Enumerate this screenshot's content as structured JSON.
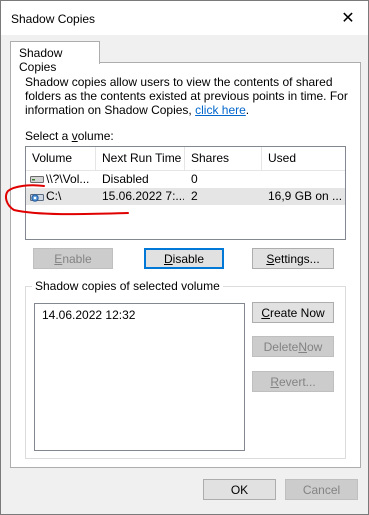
{
  "window": {
    "title": "Shadow Copies",
    "close_glyph": "✕"
  },
  "tabs": [
    {
      "label": "Shadow Copies"
    }
  ],
  "description": {
    "text": "Shadow copies allow users to view the contents of shared folders as the contents existed at previous points in time. For information on Shadow Copies, ",
    "link": "click here",
    "end": "."
  },
  "volume_section": {
    "label_prefix": "Select a ",
    "label_accel": "v",
    "label_suffix": "olume:"
  },
  "volumes": {
    "columns": [
      "Volume",
      "Next Run Time",
      "Shares",
      "Used"
    ],
    "rows": [
      {
        "volume": "\\\\?\\Vol...",
        "next_run": "Disabled",
        "shares": "0",
        "used": "",
        "icon": "drive-icon"
      },
      {
        "volume": "C:\\",
        "next_run": "15.06.2022 7:...",
        "shares": "2",
        "used": "16,9 GB on ...",
        "icon": "drive-shadow-icon",
        "selected": true
      }
    ]
  },
  "buttons": {
    "enable": {
      "accel": "E",
      "rest": "nable",
      "enabled": false
    },
    "disable": {
      "accel": "D",
      "rest": "isable",
      "enabled": true
    },
    "settings": {
      "accel": "S",
      "rest": "ettings...",
      "enabled": true
    },
    "create_now": {
      "accel": "C",
      "rest": "reate Now",
      "enabled": true
    },
    "delete_now": {
      "pre": "Delete ",
      "accel": "N",
      "rest": "ow",
      "enabled": false
    },
    "revert": {
      "accel": "R",
      "rest": "evert...",
      "enabled": false
    },
    "ok": {
      "label": "OK"
    },
    "cancel": {
      "label": "Cancel",
      "enabled": false
    }
  },
  "copies": {
    "title": "Shadow copies of selected volume",
    "items": [
      "14.06.2022 12:32"
    ]
  },
  "annotation": {
    "color": "#e00000"
  },
  "colors": {
    "link": "#0066cc",
    "selected_row": "#e5e5e5",
    "default_button_border": "#0078d7"
  }
}
